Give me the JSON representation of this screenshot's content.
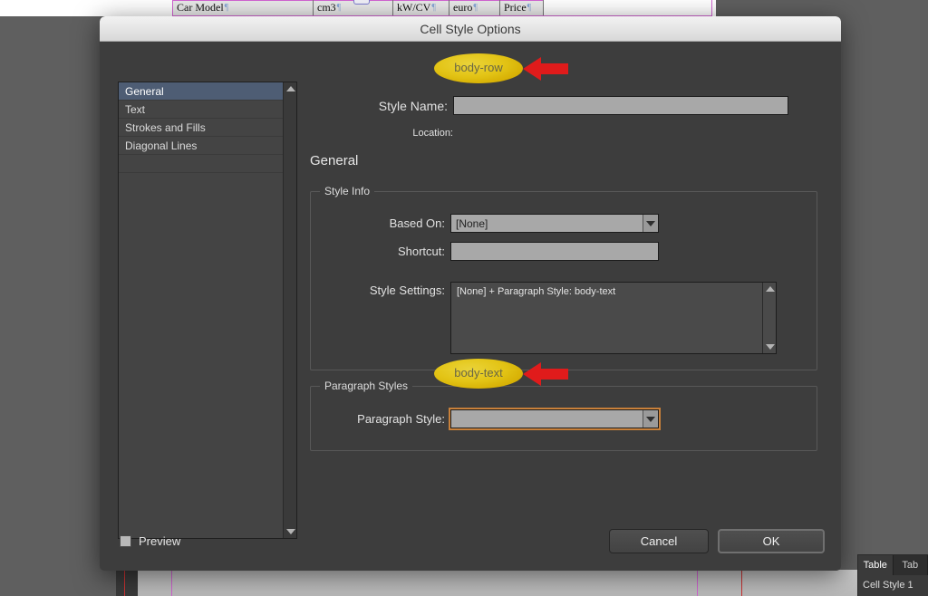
{
  "background": {
    "table": {
      "headers": [
        "Car Model",
        "cm3",
        "kW/CV",
        "euro",
        "Price",
        ""
      ],
      "mark": "¶"
    }
  },
  "dialog": {
    "title": "Cell Style Options",
    "sidebar": {
      "items": [
        {
          "label": "General",
          "selected": true
        },
        {
          "label": "Text",
          "selected": false
        },
        {
          "label": "Strokes and Fills",
          "selected": false
        },
        {
          "label": "Diagonal Lines",
          "selected": false
        }
      ],
      "scroll_up_icon": "triangle-up-icon",
      "scroll_down_icon": "triangle-down-icon"
    },
    "style_name": {
      "label": "Style Name:",
      "value": "body-row",
      "placeholder": "Style Name"
    },
    "location": {
      "label": "Location:",
      "value": ""
    },
    "section_heading": "General",
    "style_info": {
      "legend": "Style Info",
      "based_on": {
        "label": "Based On:",
        "value": "[None]",
        "options": [
          "[None]"
        ]
      },
      "shortcut": {
        "label": "Shortcut:",
        "value": "",
        "placeholder": ""
      },
      "style_settings": {
        "label": "Style Settings:",
        "value": "[None] + Paragraph Style: body-text"
      }
    },
    "paragraph_styles": {
      "legend": "Paragraph Styles",
      "paragraph_style": {
        "label": "Paragraph Style:",
        "value": "body-text",
        "options": [
          "body-text"
        ]
      }
    },
    "footer": {
      "preview_label": "Preview",
      "preview_checked": false,
      "cancel_label": "Cancel",
      "ok_label": "OK"
    }
  },
  "annotations": {
    "highlight_color": "#f0cf13",
    "arrow_color": "#e01b1b",
    "items": [
      {
        "name": "style-name-highlight",
        "text": "body-row"
      },
      {
        "name": "paragraph-style-highlight",
        "text": "body-text"
      }
    ]
  },
  "panel_bottom_right": {
    "tabs": [
      "Table",
      "Tab"
    ],
    "row_label": "Cell Style 1"
  }
}
